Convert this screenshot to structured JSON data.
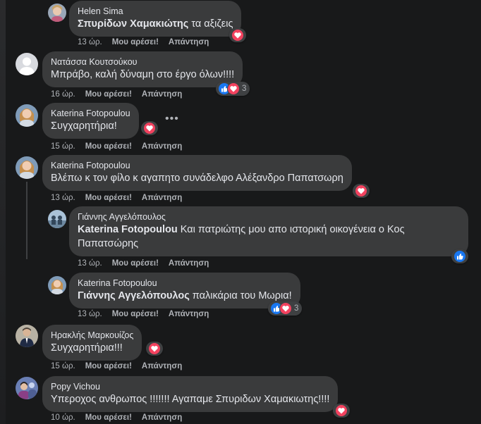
{
  "actions": {
    "like": "Μου αρέσει!",
    "reply": "Απάντηση"
  },
  "comments": [
    {
      "author": "Helen Sima",
      "mention": "Σπυρίδων Χαμακιώτης",
      "text": " τα αξιζεις",
      "time": "13 ώρ.",
      "reaction_count": ""
    },
    {
      "author": "Νατάσσα Κουτσούκου",
      "mention": "",
      "text": "Μπράβο, καλή δύναμη στο έργο όλων!!!!",
      "time": "16 ώρ.",
      "reaction_count": "3"
    },
    {
      "author": "Katerina Fotopoulou",
      "mention": "",
      "text": "Συγχαρητήρια!",
      "time": "15 ώρ.",
      "reaction_count": ""
    },
    {
      "author": "Katerina Fotopoulou",
      "mention": "",
      "text": "Βλέπω κ τον φίλο κ αγαπητο συνάδελφο Αλέξανδρο Παπατσωρη",
      "time": "13 ώρ.",
      "reaction_count": ""
    },
    {
      "author": "Γιάννης Αγγελόπουλος",
      "mention": "Katerina Fotopoulou",
      "text": " Και πατριώτης μου απο ιστορική οικογένεια ο Κος Παπατσώρης",
      "time": "13 ώρ.",
      "reaction_count": ""
    },
    {
      "author": "Katerina Fotopoulou",
      "mention": "Γιάννης Αγγελόπουλος",
      "text": " παλικάρια του Μωρια!",
      "time": "13 ώρ.",
      "reaction_count": "3"
    },
    {
      "author": "Ηρακλής Μαρκουίζος",
      "mention": "",
      "text": "Συγχαρητήρια!!!",
      "time": "15 ώρ.",
      "reaction_count": ""
    },
    {
      "author": "Popy Vichou",
      "mention": "",
      "text": "Υπεροχος ανθρωπος !!!!!!! Αγαπαμε Σπυριδων Χαμακιωτης!!!!",
      "time": "10 ώρ.",
      "reaction_count": ""
    }
  ],
  "icons": {
    "love": "heart-icon",
    "like": "thumbs-up-icon",
    "more": "more-options-icon"
  },
  "colors": {
    "background": "#18191a",
    "bubble": "#3a3b3c",
    "love": "#f3425f",
    "like": "#1877f2"
  }
}
